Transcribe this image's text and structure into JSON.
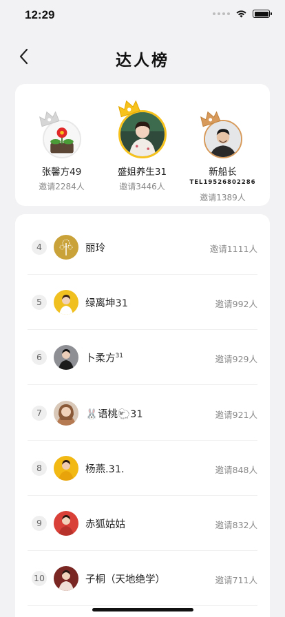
{
  "status_bar": {
    "time": "12:29"
  },
  "header": {
    "title": "达人榜"
  },
  "podium": [
    {
      "rank": 2,
      "name": "张馨方49",
      "invites": "邀请2284人",
      "avatar": "red-flower-avatar",
      "crown_color": "#d6d6d6"
    },
    {
      "rank": 1,
      "name": "盛姐养生31",
      "invites": "邀请3446人",
      "avatar": "woman-avatar",
      "crown_color": "#f7c21c"
    },
    {
      "rank": 3,
      "name": "新船长",
      "tel": "TEL19526802286",
      "invites": "邀请1389人",
      "avatar": "man-avatar",
      "crown_color": "#d79a5a"
    }
  ],
  "list": [
    {
      "rank": "4",
      "name": "丽玲",
      "invites": "邀请1111人",
      "avatar_color": "#c9a23a"
    },
    {
      "rank": "5",
      "name": "绿离坤31",
      "invites": "邀请992人",
      "avatar_color": "#f0c020"
    },
    {
      "rank": "6",
      "name": "卜柔方",
      "name_sup": "31",
      "invites": "邀请929人",
      "avatar_color": "#8d8f95"
    },
    {
      "rank": "7",
      "name": "🐰语桃🐑31",
      "invites": "邀请921人",
      "avatar_color": "#c58a5e"
    },
    {
      "rank": "8",
      "name": "杨燕.31.",
      "invites": "邀请848人",
      "avatar_color": "#f2b814"
    },
    {
      "rank": "9",
      "name": "赤狐姑姑",
      "invites": "邀请832人",
      "avatar_color": "#b8322c"
    },
    {
      "rank": "10",
      "name": "子桐（天地绝学）",
      "invites": "邀请711人",
      "avatar_color": "#a8322e"
    }
  ]
}
